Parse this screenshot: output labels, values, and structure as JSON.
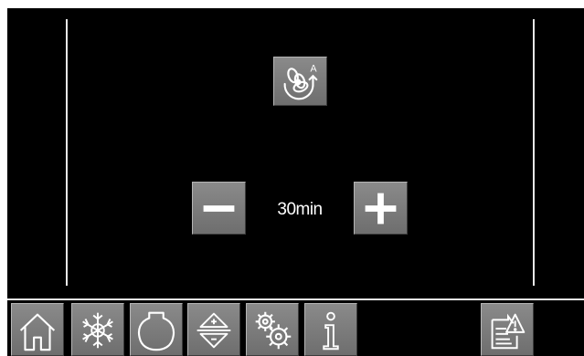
{
  "timer": {
    "value_label": "30min"
  },
  "mode_button": {
    "icon": "auto-fan-rotate-icon",
    "badge": "A"
  },
  "controls": {
    "decrease_icon": "minus-icon",
    "increase_icon": "plus-icon"
  },
  "navbar": {
    "items": [
      {
        "icon": "home-icon"
      },
      {
        "icon": "snowflake-icon"
      },
      {
        "icon": "drum-icon"
      },
      {
        "icon": "up-down-arrows-icon"
      },
      {
        "icon": "gears-icon"
      },
      {
        "icon": "info-icon"
      },
      {
        "icon": "report-warning-icon"
      }
    ]
  },
  "colors": {
    "background": "#000000",
    "button_face": "#7c7c7c",
    "icon_stroke": "#ffffff",
    "divider": "#e8e8e8"
  }
}
